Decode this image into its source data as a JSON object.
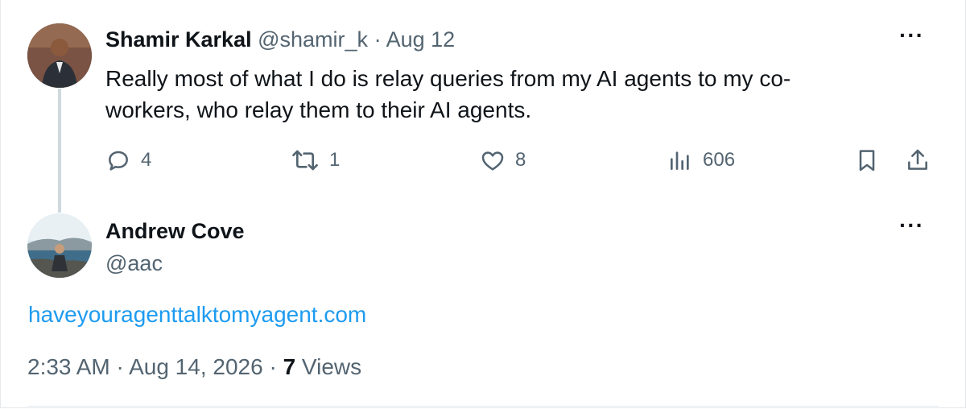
{
  "colors": {
    "accent": "#1d9bf0",
    "muted": "#536471",
    "text": "#0f1419",
    "thread": "#cfd9de"
  },
  "reply": {
    "author_name": "Shamir Karkal",
    "author_handle": "@shamir_k",
    "separator": "·",
    "date": "Aug 12",
    "more_label": "···",
    "text": "Really most of what I do is relay queries from my AI agents to my co-workers, who relay them to their AI agents.",
    "actions": {
      "replies_icon": "reply-icon",
      "replies": "4",
      "reposts_icon": "repost-icon",
      "reposts": "1",
      "likes_icon": "like-icon",
      "likes": "8",
      "views_icon": "views-icon",
      "views": "606",
      "bookmark_icon": "bookmark-icon",
      "share_icon": "share-icon"
    }
  },
  "main_post": {
    "author_name": "Andrew Cove",
    "author_handle": "@aac",
    "more_label": "···",
    "link_text": "haveyouragenttalktomyagent.com",
    "time": "2:33 AM",
    "separator": "·",
    "date": "Aug 14, 2026",
    "separator2": "·",
    "views_count": "7",
    "views_label": "Views"
  }
}
